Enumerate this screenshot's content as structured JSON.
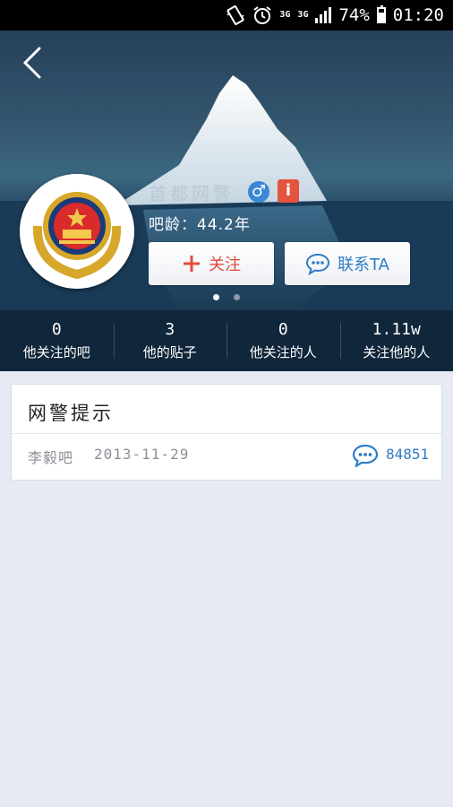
{
  "status_bar": {
    "network_1": "3G",
    "network_2": "3G",
    "battery_text": "74%",
    "battery_level": 0.74,
    "time": "01:20"
  },
  "profile": {
    "username": "首都网警",
    "gender_symbol": "♂",
    "info_badge": "i",
    "age": "吧龄：44.2年",
    "follow_label": "关注",
    "contact_label": "联系TA",
    "carousel_pages": 2,
    "carousel_active": 1
  },
  "stats": [
    {
      "value": "0",
      "label": "他关注的吧"
    },
    {
      "value": "3",
      "label": "他的贴子"
    },
    {
      "value": "0",
      "label": "他关注的人"
    },
    {
      "value": "1.11w",
      "label": "关注他的人"
    }
  ],
  "post": {
    "title": "网警提示",
    "forum": "李毅吧",
    "date": "2013-11-29",
    "comment_count": "84851"
  },
  "colors": {
    "accent_blue": "#2f7cc6",
    "follow_red": "#e24b3d",
    "stats_bg": "#10263a",
    "page_bg": "#e6eaf2"
  }
}
